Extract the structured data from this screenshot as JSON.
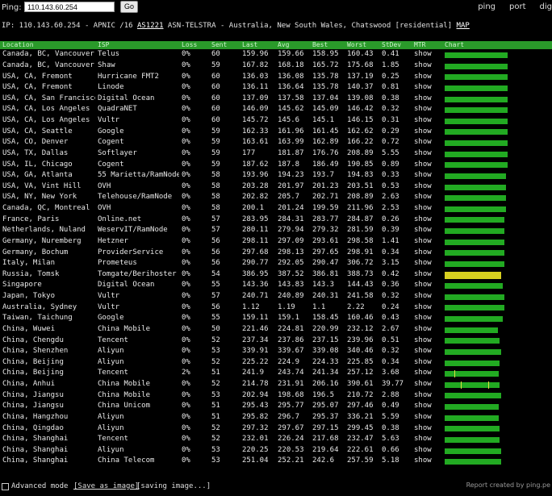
{
  "header": {
    "ping_label": "Ping:",
    "ping_value": "110.143.60.254",
    "go_label": "Go",
    "links": [
      "ping",
      "port",
      "dig"
    ]
  },
  "ipinfo": {
    "prefix": "IP: 110.143.60.254 - APNIC /16 ",
    "asn": "AS1221",
    "details": " ASN-TELSTRA - Australia, New South Wales, Chatswood [residential] ",
    "map": "MAP"
  },
  "table": {
    "columns": [
      "Location",
      "ISP",
      "Loss",
      "Sent",
      "Last",
      "Avg",
      "Best",
      "Worst",
      "StDev",
      "MTR",
      "Chart"
    ],
    "mtr_label": "show",
    "rows": [
      {
        "location": "Canada, BC, Vancouver",
        "isp": "Telus",
        "loss": "0%",
        "sent": "60",
        "last": "159.96",
        "avg": "159.66",
        "best": "158.95",
        "worst": "160.43",
        "stdev": "0.41",
        "bar": 0.98
      },
      {
        "location": "Canada, BC, Vancouver",
        "isp": "Shaw",
        "loss": "0%",
        "sent": "59",
        "last": "167.82",
        "avg": "168.18",
        "best": "165.72",
        "worst": "175.68",
        "stdev": "1.85",
        "bar": 0.98
      },
      {
        "location": "USA, CA, Fremont",
        "isp": "Hurricane FMT2",
        "loss": "0%",
        "sent": "60",
        "last": "136.03",
        "avg": "136.08",
        "best": "135.78",
        "worst": "137.19",
        "stdev": "0.25",
        "bar": 0.98
      },
      {
        "location": "USA, CA, Fremont",
        "isp": "Linode",
        "loss": "0%",
        "sent": "60",
        "last": "136.11",
        "avg": "136.64",
        "best": "135.78",
        "worst": "140.37",
        "stdev": "0.81",
        "bar": 0.98
      },
      {
        "location": "USA, CA, San Francisco",
        "isp": "Digital Ocean",
        "loss": "0%",
        "sent": "60",
        "last": "137.09",
        "avg": "137.58",
        "best": "137.04",
        "worst": "139.08",
        "stdev": "0.38",
        "bar": 0.98
      },
      {
        "location": "USA, CA, Los Angeles",
        "isp": "QuadraNET",
        "loss": "0%",
        "sent": "60",
        "last": "146.09",
        "avg": "145.62",
        "best": "145.09",
        "worst": "146.42",
        "stdev": "0.32",
        "bar": 0.98
      },
      {
        "location": "USA, CA, Los Angeles",
        "isp": "Vultr",
        "loss": "0%",
        "sent": "60",
        "last": "145.72",
        "avg": "145.6",
        "best": "145.1",
        "worst": "146.15",
        "stdev": "0.31",
        "bar": 0.98
      },
      {
        "location": "USA, CA, Seattle",
        "isp": "Google",
        "loss": "0%",
        "sent": "59",
        "last": "162.33",
        "avg": "161.96",
        "best": "161.45",
        "worst": "162.62",
        "stdev": "0.29",
        "bar": 0.97
      },
      {
        "location": "USA, CO, Denver",
        "isp": "Cogent",
        "loss": "0%",
        "sent": "59",
        "last": "163.61",
        "avg": "163.99",
        "best": "162.89",
        "worst": "166.22",
        "stdev": "0.72",
        "bar": 0.97
      },
      {
        "location": "USA, TX, Dallas",
        "isp": "Softlayer",
        "loss": "0%",
        "sent": "59",
        "last": "177",
        "avg": "181.87",
        "best": "176.76",
        "worst": "208.89",
        "stdev": "5.55",
        "bar": 0.97
      },
      {
        "location": "USA, IL, Chicago",
        "isp": "Cogent",
        "loss": "0%",
        "sent": "59",
        "last": "187.62",
        "avg": "187.8",
        "best": "186.49",
        "worst": "190.85",
        "stdev": "0.89",
        "bar": 0.97
      },
      {
        "location": "USA, GA, Atlanta",
        "isp": "55 Marietta/RamNode",
        "loss": "0%",
        "sent": "58",
        "last": "193.96",
        "avg": "194.23",
        "best": "193.7",
        "worst": "194.83",
        "stdev": "0.33",
        "bar": 0.95
      },
      {
        "location": "USA, VA, Vint Hill",
        "isp": "OVH",
        "loss": "0%",
        "sent": "58",
        "last": "203.28",
        "avg": "201.97",
        "best": "201.23",
        "worst": "203.51",
        "stdev": "0.53",
        "bar": 0.95
      },
      {
        "location": "USA, NY, New York",
        "isp": "Telehouse/RamNode",
        "loss": "0%",
        "sent": "58",
        "last": "202.82",
        "avg": "205.7",
        "best": "202.71",
        "worst": "208.89",
        "stdev": "2.63",
        "bar": 0.95
      },
      {
        "location": "Canada, QC, Montreal",
        "isp": "OVH",
        "loss": "0%",
        "sent": "58",
        "last": "200.1",
        "avg": "201.24",
        "best": "199.59",
        "worst": "211.96",
        "stdev": "2.53",
        "bar": 0.95
      },
      {
        "location": "France, Paris",
        "isp": "Online.net",
        "loss": "0%",
        "sent": "57",
        "last": "283.95",
        "avg": "284.31",
        "best": "283.77",
        "worst": "284.87",
        "stdev": "0.26",
        "bar": 0.93
      },
      {
        "location": "Netherlands, Nuland",
        "isp": "WeservIT/RamNode",
        "loss": "0%",
        "sent": "57",
        "last": "280.11",
        "avg": "279.94",
        "best": "279.32",
        "worst": "281.59",
        "stdev": "0.39",
        "bar": 0.93
      },
      {
        "location": "Germany, Nuremberg",
        "isp": "Hetzner",
        "loss": "0%",
        "sent": "56",
        "last": "298.11",
        "avg": "297.09",
        "best": "293.61",
        "worst": "298.58",
        "stdev": "1.41",
        "bar": 0.92
      },
      {
        "location": "Germany, Bochum",
        "isp": "ProviderService",
        "loss": "0%",
        "sent": "56",
        "last": "297.68",
        "avg": "298.13",
        "best": "297.65",
        "worst": "298.91",
        "stdev": "0.34",
        "bar": 0.92
      },
      {
        "location": "Italy, Milan",
        "isp": "Prometeus",
        "loss": "0%",
        "sent": "56",
        "last": "290.77",
        "avg": "292.05",
        "best": "290.47",
        "worst": "306.72",
        "stdev": "3.15",
        "bar": 0.92
      },
      {
        "location": "Russia, Tomsk",
        "isp": "Tomgate/Berihoster",
        "loss": "0%",
        "sent": "54",
        "last": "386.95",
        "avg": "387.52",
        "best": "386.81",
        "worst": "388.73",
        "stdev": "0.42",
        "bar": 0.88,
        "yellow": true
      },
      {
        "location": "Singapore",
        "isp": "Digital Ocean",
        "loss": "0%",
        "sent": "55",
        "last": "143.36",
        "avg": "143.83",
        "best": "143.3",
        "worst": "144.43",
        "stdev": "0.36",
        "bar": 0.9
      },
      {
        "location": "Japan, Tokyo",
        "isp": "Vultr",
        "loss": "0%",
        "sent": "57",
        "last": "240.71",
        "avg": "240.89",
        "best": "240.31",
        "worst": "241.58",
        "stdev": "0.32",
        "bar": 0.93
      },
      {
        "location": "Australia, Sydney",
        "isp": "Vultr",
        "loss": "0%",
        "sent": "56",
        "last": "1.12",
        "avg": "1.19",
        "best": "1.1",
        "worst": "2.22",
        "stdev": "0.24",
        "bar": 0.92
      },
      {
        "location": "Taiwan, Taichung",
        "isp": "Google",
        "loss": "0%",
        "sent": "55",
        "last": "159.11",
        "avg": "159.1",
        "best": "158.45",
        "worst": "160.46",
        "stdev": "0.43",
        "bar": 0.9
      },
      {
        "location": "China, Wuwei",
        "isp": "China Mobile",
        "loss": "0%",
        "sent": "50",
        "last": "221.46",
        "avg": "224.81",
        "best": "220.99",
        "worst": "232.12",
        "stdev": "2.67",
        "bar": 0.82
      },
      {
        "location": "China, Chengdu",
        "isp": "Tencent",
        "loss": "0%",
        "sent": "52",
        "last": "237.34",
        "avg": "237.86",
        "best": "237.15",
        "worst": "239.96",
        "stdev": "0.51",
        "bar": 0.85
      },
      {
        "location": "China, Shenzhen",
        "isp": "Aliyun",
        "loss": "0%",
        "sent": "53",
        "last": "339.91",
        "avg": "339.67",
        "best": "339.08",
        "worst": "340.46",
        "stdev": "0.32",
        "bar": 0.87
      },
      {
        "location": "China, Beijing",
        "isp": "Aliyun",
        "loss": "0%",
        "sent": "52",
        "last": "225.22",
        "avg": "224.9",
        "best": "224.33",
        "worst": "225.85",
        "stdev": "0.34",
        "bar": 0.85
      },
      {
        "location": "China, Beijing",
        "isp": "Tencent",
        "loss": "2%",
        "sent": "51",
        "last": "241.9",
        "avg": "243.74",
        "best": "241.34",
        "worst": "257.12",
        "stdev": "3.68",
        "bar": 0.84,
        "ticks": [
          0.18
        ]
      },
      {
        "location": "China, Anhui",
        "isp": "China Mobile",
        "loss": "0%",
        "sent": "52",
        "last": "214.78",
        "avg": "231.91",
        "best": "206.16",
        "worst": "390.61",
        "stdev": "39.77",
        "bar": 0.85,
        "ticks": [
          0.3,
          0.8
        ]
      },
      {
        "location": "China, Jiangsu",
        "isp": "China Mobile",
        "loss": "0%",
        "sent": "53",
        "last": "202.94",
        "avg": "198.68",
        "best": "196.5",
        "worst": "210.72",
        "stdev": "2.88",
        "bar": 0.87
      },
      {
        "location": "China, Jiangsu",
        "isp": "China Unicom",
        "loss": "0%",
        "sent": "51",
        "last": "295.43",
        "avg": "295.77",
        "best": "295.07",
        "worst": "297.46",
        "stdev": "0.49",
        "bar": 0.84
      },
      {
        "location": "China, Hangzhou",
        "isp": "Aliyun",
        "loss": "0%",
        "sent": "51",
        "last": "295.82",
        "avg": "296.7",
        "best": "295.37",
        "worst": "336.21",
        "stdev": "5.59",
        "bar": 0.84
      },
      {
        "location": "China, Qingdao",
        "isp": "Aliyun",
        "loss": "0%",
        "sent": "52",
        "last": "297.32",
        "avg": "297.67",
        "best": "297.15",
        "worst": "299.45",
        "stdev": "0.38",
        "bar": 0.85
      },
      {
        "location": "China, Shanghai",
        "isp": "Tencent",
        "loss": "0%",
        "sent": "52",
        "last": "232.01",
        "avg": "226.24",
        "best": "217.68",
        "worst": "232.47",
        "stdev": "5.63",
        "bar": 0.85
      },
      {
        "location": "China, Shanghai",
        "isp": "Aliyun",
        "loss": "0%",
        "sent": "53",
        "last": "220.25",
        "avg": "220.53",
        "best": "219.64",
        "worst": "222.61",
        "stdev": "0.66",
        "bar": 0.87
      },
      {
        "location": "China, Shanghai",
        "isp": "China Telecom",
        "loss": "0%",
        "sent": "53",
        "last": "251.04",
        "avg": "252.21",
        "best": "242.6",
        "worst": "257.59",
        "stdev": "5.18",
        "bar": 0.87
      }
    ]
  },
  "footer": {
    "advanced_label": "Advanced mode",
    "save_link": "[Save as image]",
    "saving_text": "[saving image...]",
    "report_text": "Report created by ping.pe"
  },
  "colors": {
    "header_bg": "#2a9a2a",
    "bar_green": "#22aa22",
    "bar_yellow": "#d8d020",
    "mtr_link": "#3ccf3c"
  }
}
